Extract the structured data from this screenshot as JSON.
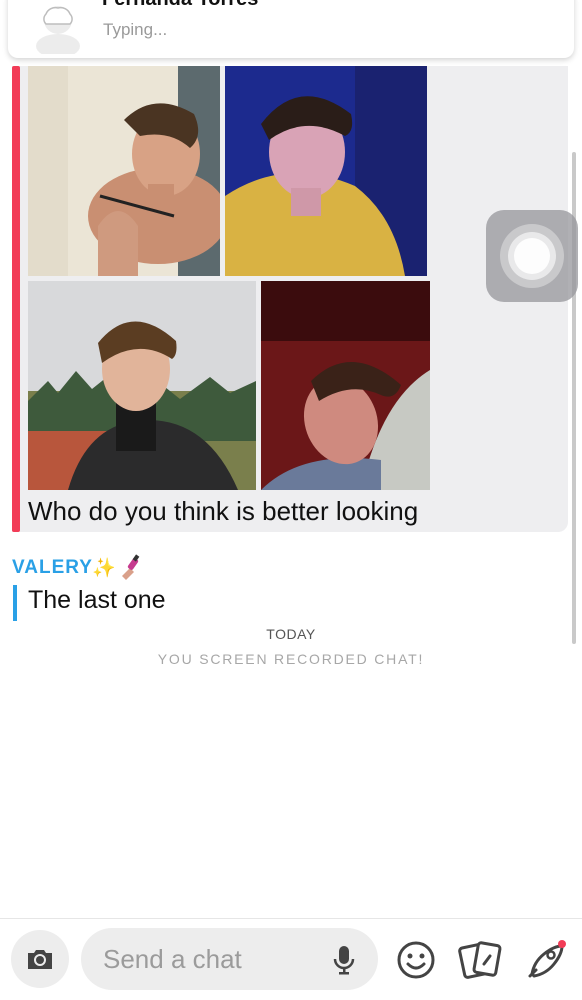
{
  "header": {
    "name": "Fernanda Torres",
    "status": "Typing..."
  },
  "message": {
    "text": "Who do you think is better looking",
    "photos": [
      "photo-1",
      "photo-2",
      "photo-3",
      "photo-4"
    ],
    "accent_color": "#f23c57"
  },
  "reply": {
    "sender": "VALERY",
    "sender_emoji": "✨",
    "text": "The last one",
    "accent_color": "#2aa0e6"
  },
  "timeline": {
    "day_label": "TODAY",
    "system_note": "YOU SCREEN RECORDED CHAT!"
  },
  "composer": {
    "placeholder": "Send a chat",
    "icons": [
      "camera-icon",
      "microphone-icon",
      "emoji-icon",
      "cards-icon",
      "rocket-icon"
    ]
  }
}
